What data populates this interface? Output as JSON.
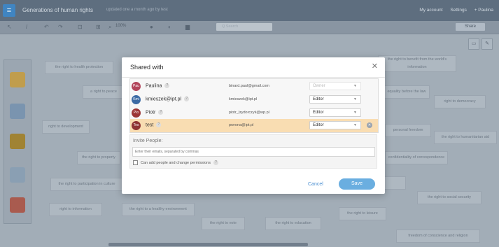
{
  "app": {
    "doc_title": "Generations of human rights",
    "saved_text": "updated one a month ago by test",
    "top_links": [
      "My account",
      "Settings",
      "+ Paulina"
    ],
    "zoom": "100%",
    "search_placeholder": "Q Search",
    "share_label": "Share"
  },
  "canvas_cards": [
    "the right to health protection",
    "a right to peace",
    "right to development",
    "the right to property",
    "the right to participation in culture",
    "right to information",
    "the right to a healthy environment",
    "the right to vote",
    "the right to education",
    "the right to leisure",
    "equality before the law",
    "personal freedom",
    "confidentiality of correspondence",
    "the right to social security",
    "freedom of conscience and religion",
    "right to democracy",
    "the right to humanitarian aid",
    "the right to benefit from the world's information"
  ],
  "modal": {
    "title": "Shared with",
    "users": [
      {
        "initials": "Pau",
        "name": "Paulina",
        "email": "binard.paul@gmail.com",
        "role": "Owner",
        "color": "#b2455b"
      },
      {
        "initials": "Kmi",
        "name": "kmieszek@ipt.pl",
        "email": "kmieszek@ipt.pl",
        "role": "Editor",
        "color": "#3c6ba5"
      },
      {
        "initials": "Pio",
        "name": "Piotr",
        "email": "piotr_lzydorczyk@wp.pl",
        "role": "Editor",
        "color": "#9c3535"
      },
      {
        "initials": "Tes",
        "name": "test",
        "email": "pwrona@ipt.pl",
        "role": "Editor",
        "color": "#8e3434"
      }
    ],
    "invite_label": "Invite People:",
    "invite_placeholder": "Enter their emails, separated by commas",
    "permission_label": "Can add people and change permissions",
    "cancel_label": "Cancel",
    "save_label": "Save"
  },
  "colors": {
    "accent": "#6aaee0",
    "highlight_row": "#f9ddb2"
  }
}
